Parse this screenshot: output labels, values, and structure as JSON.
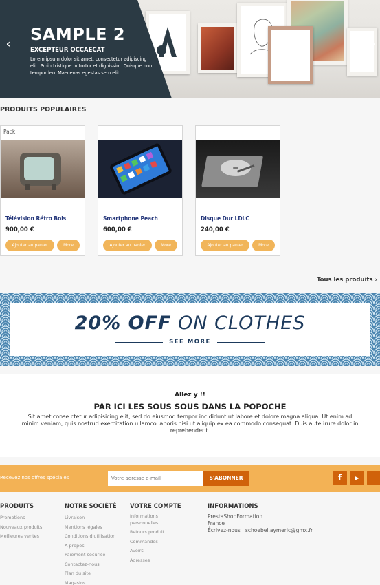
{
  "hero": {
    "title": "SAMPLE 2",
    "subtitle": "EXCEPTEUR OCCAECAT",
    "text": "Lorem ipsum dolor sit amet, consectetur adipiscing elit. Proin tristique in tortor et dignissim. Quisque non tempor leo. Maecenas egestas sem elit",
    "prev_icon": "chevron-left-icon",
    "next_icon": "chevron-right-icon"
  },
  "popular": {
    "title": "PRODUITS POPULAIRES",
    "all_link": "Tous les produits",
    "products": [
      {
        "flag": "Pack",
        "name": "Télévision Rétro Bois",
        "price": "900,00 €",
        "cart": "Ajouter au panier",
        "more": "More"
      },
      {
        "flag": "",
        "name": "Smartphone Peach",
        "price": "600,00 €",
        "cart": "Ajouter au panier",
        "more": "More"
      },
      {
        "flag": "",
        "name": "Disque Dur LDLC",
        "price": "240,00 €",
        "cart": "Ajouter au panier",
        "more": "More"
      }
    ]
  },
  "promo": {
    "bold": "20% OFF",
    "rest": " ON CLOTHES",
    "see_more": "SEE MORE",
    "colors": {
      "pattern": "#5a8fb5",
      "text": "#1d3a5c"
    }
  },
  "info": {
    "kicker": "Allez y !!",
    "title": "PAR ICI LES SOUS SOUS DANS LA POPOCHE",
    "text": "Sit amet conse ctetur adipisicing elit, sed do eiusmod tempor incididunt ut labore et dolore magna aliqua. Ut enim ad minim veniam, quis nostrud exercitation ullamco laboris nisi ut aliquip ex ea commodo consequat. Duis aute irure dolor in reprehenderit."
  },
  "newsletter": {
    "label": "Recevez nos offres spéciales",
    "placeholder": "Votre adresse e-mail",
    "button": "S'ABONNER",
    "colors": {
      "bar": "#f3b255",
      "button": "#d0620a"
    },
    "socials": [
      {
        "icon": "facebook-icon",
        "glyph": "f"
      },
      {
        "icon": "youtube-icon",
        "glyph": "▶"
      },
      {
        "icon": "social-icon",
        "glyph": ""
      }
    ]
  },
  "footer": {
    "produits": {
      "title": "PRODUITS",
      "links": [
        "Promotions",
        "Nouveaux produits",
        "Meilleures ventes"
      ]
    },
    "societe": {
      "title": "NOTRE SOCIÉTÉ",
      "links": [
        "Livraison",
        "Mentions légales",
        "Conditions d'utilisation",
        "A propos",
        "Paiement sécurisé",
        "Contactez-nous",
        "Plan du site",
        "Magasins"
      ]
    },
    "compte": {
      "title": "VOTRE COMPTE",
      "links": [
        "Informations personnelles",
        "Retours produit",
        "Commandes",
        "Avoirs",
        "Adresses"
      ]
    },
    "informations": {
      "title": "INFORMATIONS",
      "lines": [
        "PrestaShopFormation",
        "France",
        "Écrivez-nous : schoebel.aymeric@gmx.fr"
      ]
    }
  }
}
